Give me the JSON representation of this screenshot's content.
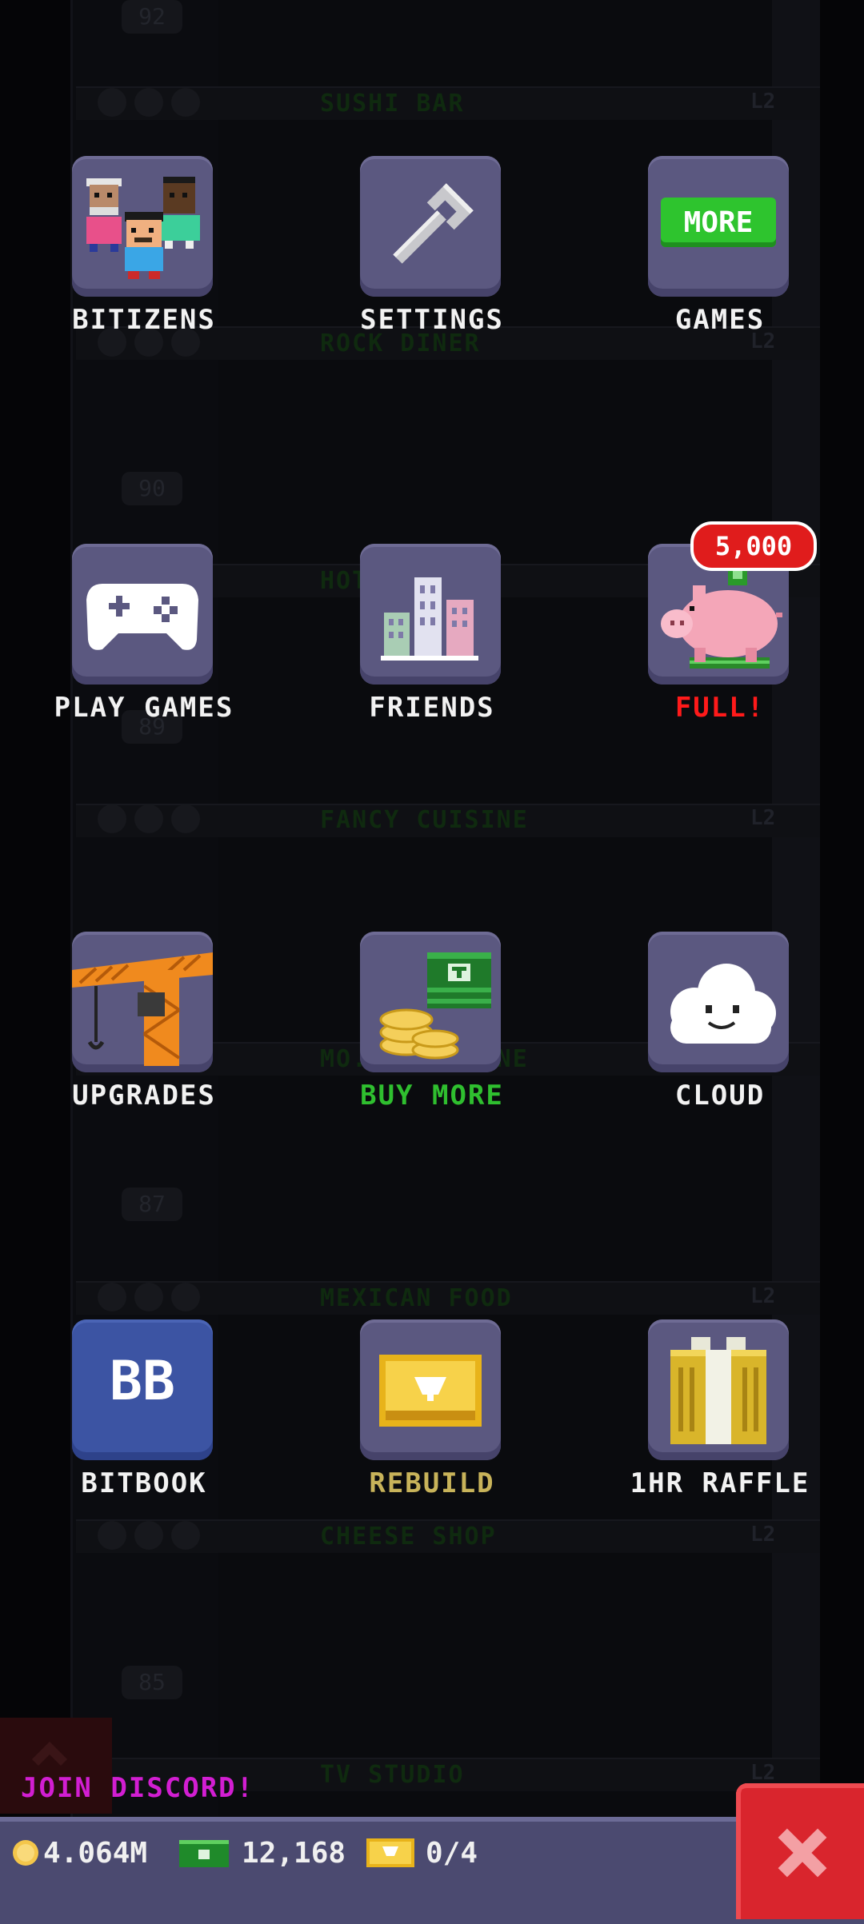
{
  "background": {
    "floors": [
      {
        "name": "SUSHI BAR",
        "level": "L2"
      },
      {
        "name": "ROCK DINER",
        "level": "L2"
      },
      {
        "name": "HOT...POINT",
        "level": ""
      },
      {
        "name": "FANCY CUISINE",
        "level": "L2"
      },
      {
        "name": "MO... CUISINE",
        "level": ""
      },
      {
        "name": "MEXICAN FOOD",
        "level": "L2"
      },
      {
        "name": "CHEESE SHOP",
        "level": "L2"
      },
      {
        "name": "TV STUDIO",
        "level": "L2"
      }
    ],
    "floor_numbers": [
      "92",
      "90",
      "89",
      "87",
      "85"
    ]
  },
  "menu": {
    "bitizens": {
      "label": "BITIZENS",
      "icon": "bitizens-icon"
    },
    "settings": {
      "label": "SETTINGS",
      "icon": "wrench-icon"
    },
    "games": {
      "label": "GAMES",
      "icon": "more-games-icon",
      "badge": "MORE"
    },
    "play_games": {
      "label": "PLAY GAMES",
      "icon": "gamepad-icon"
    },
    "friends": {
      "label": "FRIENDS",
      "icon": "city-icon"
    },
    "piggy": {
      "label": "FULL!",
      "icon": "piggy-bank-icon",
      "badge": "5,000"
    },
    "upgrades": {
      "label": "UPGRADES",
      "icon": "crane-icon"
    },
    "buy_more": {
      "label": "BUY MORE",
      "icon": "coins-bux-icon"
    },
    "cloud": {
      "label": "CLOUD",
      "icon": "cloud-icon"
    },
    "bitbook": {
      "label": "BITBOOK",
      "icon": "bitbook-icon",
      "badge": "BB"
    },
    "rebuild": {
      "label": "REBUILD",
      "icon": "golden-ticket-icon"
    },
    "raffle": {
      "label": "1HR RAFFLE",
      "icon": "raffle-ticket-icon"
    }
  },
  "footer": {
    "join_discord": "JOIN DISCORD!",
    "coins": "4.064M",
    "bux": "12,168",
    "tickets": "0/4"
  },
  "colors": {
    "tile": "#5b5880",
    "tile_blue": "#3c54a3",
    "label_green": "#2fbf2f",
    "label_red": "#ff1a1a",
    "label_gold": "#c8b35a",
    "discord": "#d21ed2",
    "close_red": "#d9252d"
  }
}
